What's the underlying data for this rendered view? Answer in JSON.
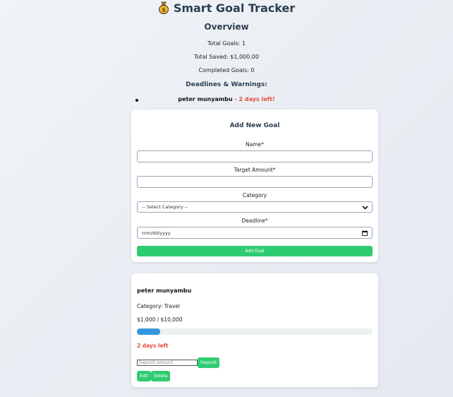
{
  "app": {
    "title": "Smart Goal Tracker",
    "icon": "moneybag-icon"
  },
  "overview": {
    "title": "Overview",
    "total_goals": "Total Goals: 1",
    "total_saved": "Total Saved: $1,000.00",
    "completed_goals": "Completed Goals: 0"
  },
  "warnings": {
    "title": "Deadlines & Warnings:",
    "items": [
      {
        "name": "peter munyambu",
        "separator": " - ",
        "days": "2 days left!"
      }
    ]
  },
  "form": {
    "title": "Add New Goal",
    "name_label": "Name*",
    "name_value": "",
    "target_label": "Target Amount*",
    "target_value": "",
    "category_label": "Category",
    "category_selected": "-- Select Category --",
    "deadline_label": "Deadline*",
    "deadline_placeholder": "mm/dd/yyyy",
    "submit_label": "Add Goal"
  },
  "goal": {
    "name": "peter munyambu",
    "category": "Category: Travel",
    "amount": "$1,000 / $10,000",
    "progress_fraction": 0.1,
    "days_left": "2 days left",
    "deposit_placeholder": "Deposit amount",
    "deposit_label": "Deposit",
    "edit_label": "Edit",
    "delete_label": "Delete"
  },
  "colors": {
    "accent_green": "#2ecc71",
    "progress_blue": "#3498db",
    "warning_red": "#e74c3c",
    "heading": "#2c3e50"
  }
}
